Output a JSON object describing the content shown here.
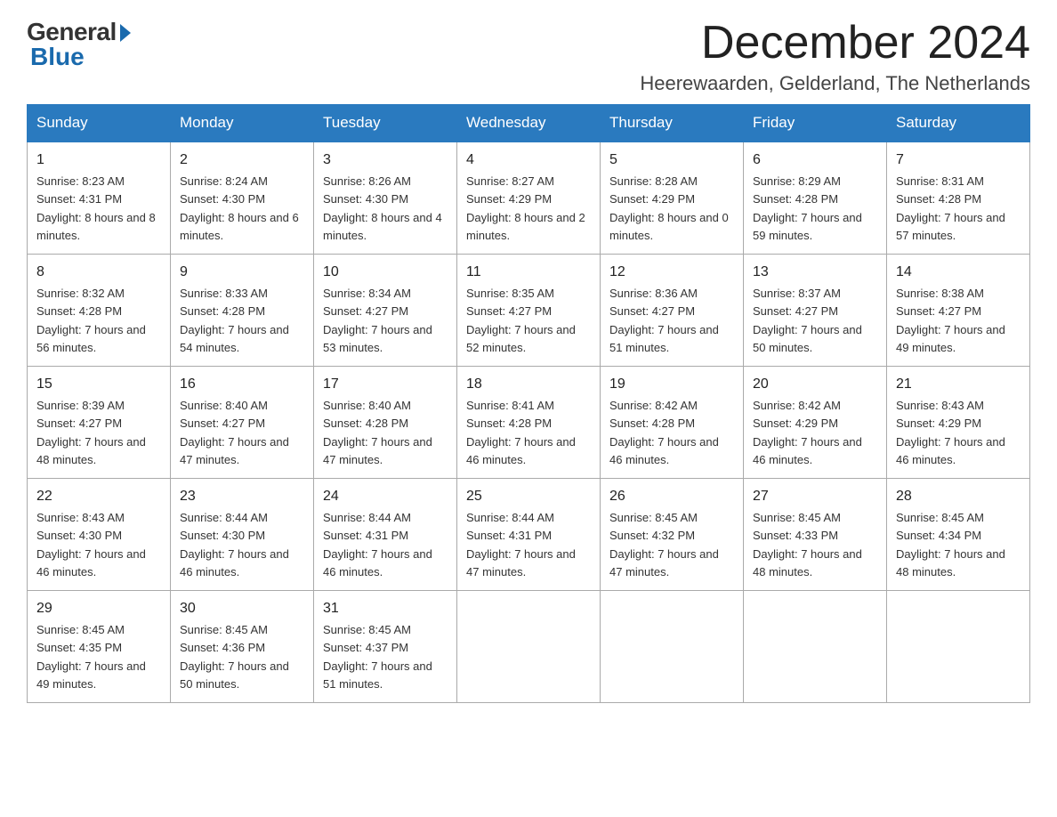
{
  "logo": {
    "general": "General",
    "blue": "Blue"
  },
  "title": "December 2024",
  "subtitle": "Heerewaarden, Gelderland, The Netherlands",
  "days_of_week": [
    "Sunday",
    "Monday",
    "Tuesday",
    "Wednesday",
    "Thursday",
    "Friday",
    "Saturday"
  ],
  "weeks": [
    [
      {
        "day": "1",
        "sunrise": "8:23 AM",
        "sunset": "4:31 PM",
        "daylight": "8 hours and 8 minutes."
      },
      {
        "day": "2",
        "sunrise": "8:24 AM",
        "sunset": "4:30 PM",
        "daylight": "8 hours and 6 minutes."
      },
      {
        "day": "3",
        "sunrise": "8:26 AM",
        "sunset": "4:30 PM",
        "daylight": "8 hours and 4 minutes."
      },
      {
        "day": "4",
        "sunrise": "8:27 AM",
        "sunset": "4:29 PM",
        "daylight": "8 hours and 2 minutes."
      },
      {
        "day": "5",
        "sunrise": "8:28 AM",
        "sunset": "4:29 PM",
        "daylight": "8 hours and 0 minutes."
      },
      {
        "day": "6",
        "sunrise": "8:29 AM",
        "sunset": "4:28 PM",
        "daylight": "7 hours and 59 minutes."
      },
      {
        "day": "7",
        "sunrise": "8:31 AM",
        "sunset": "4:28 PM",
        "daylight": "7 hours and 57 minutes."
      }
    ],
    [
      {
        "day": "8",
        "sunrise": "8:32 AM",
        "sunset": "4:28 PM",
        "daylight": "7 hours and 56 minutes."
      },
      {
        "day": "9",
        "sunrise": "8:33 AM",
        "sunset": "4:28 PM",
        "daylight": "7 hours and 54 minutes."
      },
      {
        "day": "10",
        "sunrise": "8:34 AM",
        "sunset": "4:27 PM",
        "daylight": "7 hours and 53 minutes."
      },
      {
        "day": "11",
        "sunrise": "8:35 AM",
        "sunset": "4:27 PM",
        "daylight": "7 hours and 52 minutes."
      },
      {
        "day": "12",
        "sunrise": "8:36 AM",
        "sunset": "4:27 PM",
        "daylight": "7 hours and 51 minutes."
      },
      {
        "day": "13",
        "sunrise": "8:37 AM",
        "sunset": "4:27 PM",
        "daylight": "7 hours and 50 minutes."
      },
      {
        "day": "14",
        "sunrise": "8:38 AM",
        "sunset": "4:27 PM",
        "daylight": "7 hours and 49 minutes."
      }
    ],
    [
      {
        "day": "15",
        "sunrise": "8:39 AM",
        "sunset": "4:27 PM",
        "daylight": "7 hours and 48 minutes."
      },
      {
        "day": "16",
        "sunrise": "8:40 AM",
        "sunset": "4:27 PM",
        "daylight": "7 hours and 47 minutes."
      },
      {
        "day": "17",
        "sunrise": "8:40 AM",
        "sunset": "4:28 PM",
        "daylight": "7 hours and 47 minutes."
      },
      {
        "day": "18",
        "sunrise": "8:41 AM",
        "sunset": "4:28 PM",
        "daylight": "7 hours and 46 minutes."
      },
      {
        "day": "19",
        "sunrise": "8:42 AM",
        "sunset": "4:28 PM",
        "daylight": "7 hours and 46 minutes."
      },
      {
        "day": "20",
        "sunrise": "8:42 AM",
        "sunset": "4:29 PM",
        "daylight": "7 hours and 46 minutes."
      },
      {
        "day": "21",
        "sunrise": "8:43 AM",
        "sunset": "4:29 PM",
        "daylight": "7 hours and 46 minutes."
      }
    ],
    [
      {
        "day": "22",
        "sunrise": "8:43 AM",
        "sunset": "4:30 PM",
        "daylight": "7 hours and 46 minutes."
      },
      {
        "day": "23",
        "sunrise": "8:44 AM",
        "sunset": "4:30 PM",
        "daylight": "7 hours and 46 minutes."
      },
      {
        "day": "24",
        "sunrise": "8:44 AM",
        "sunset": "4:31 PM",
        "daylight": "7 hours and 46 minutes."
      },
      {
        "day": "25",
        "sunrise": "8:44 AM",
        "sunset": "4:31 PM",
        "daylight": "7 hours and 47 minutes."
      },
      {
        "day": "26",
        "sunrise": "8:45 AM",
        "sunset": "4:32 PM",
        "daylight": "7 hours and 47 minutes."
      },
      {
        "day": "27",
        "sunrise": "8:45 AM",
        "sunset": "4:33 PM",
        "daylight": "7 hours and 48 minutes."
      },
      {
        "day": "28",
        "sunrise": "8:45 AM",
        "sunset": "4:34 PM",
        "daylight": "7 hours and 48 minutes."
      }
    ],
    [
      {
        "day": "29",
        "sunrise": "8:45 AM",
        "sunset": "4:35 PM",
        "daylight": "7 hours and 49 minutes."
      },
      {
        "day": "30",
        "sunrise": "8:45 AM",
        "sunset": "4:36 PM",
        "daylight": "7 hours and 50 minutes."
      },
      {
        "day": "31",
        "sunrise": "8:45 AM",
        "sunset": "4:37 PM",
        "daylight": "7 hours and 51 minutes."
      },
      null,
      null,
      null,
      null
    ]
  ]
}
